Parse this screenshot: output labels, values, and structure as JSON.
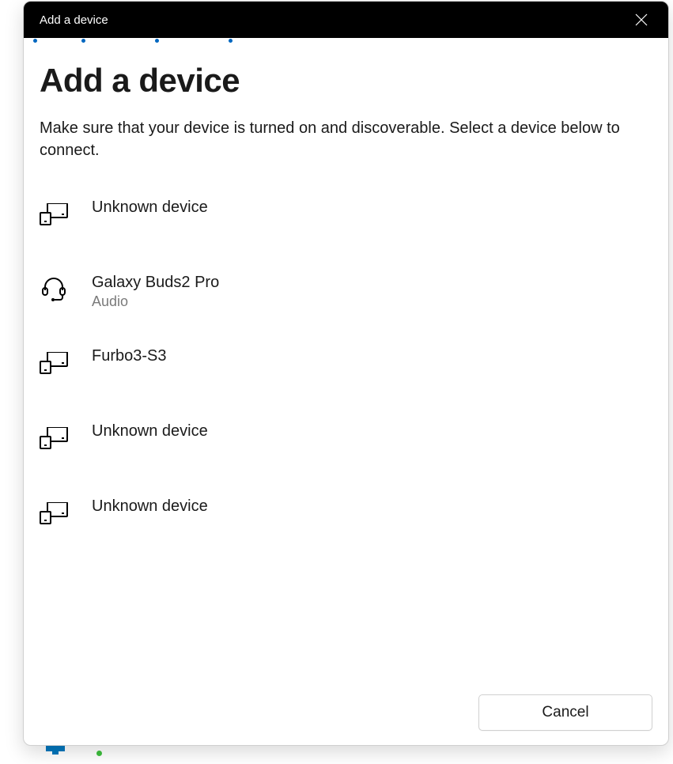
{
  "titlebar": {
    "title": "Add a device"
  },
  "heading": "Add a device",
  "description": "Make sure that your device is turned on and discoverable. Select a device below to connect.",
  "devices": [
    {
      "name": "Unknown device",
      "type": "",
      "icon": "device"
    },
    {
      "name": "Galaxy Buds2 Pro",
      "type": "Audio",
      "icon": "headset"
    },
    {
      "name": "Furbo3-S3",
      "type": "",
      "icon": "device"
    },
    {
      "name": "Unknown device",
      "type": "",
      "icon": "device"
    },
    {
      "name": "Unknown device",
      "type": "",
      "icon": "device"
    }
  ],
  "footer": {
    "cancel_label": "Cancel"
  }
}
